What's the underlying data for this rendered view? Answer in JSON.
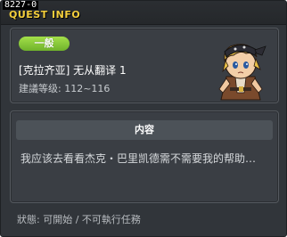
{
  "window": {
    "id": "8227-0",
    "title": "QUEST INFO"
  },
  "quest": {
    "category": "一般",
    "name": "[克拉齐亚] 无从翻译 1",
    "level_requirement": "建議等级: 112~116",
    "npc_icon": "npc-portrait-pirate"
  },
  "content": {
    "header": "内容",
    "text": "我应该去看看杰克・巴里凯德需不需要我的帮助…"
  },
  "status": {
    "text": "狀態: 可開始 / 不可執行任務"
  },
  "colors": {
    "title_accent": "#f3ce3c",
    "badge_green": "#8cc83a",
    "window_bg": "#31353a"
  }
}
